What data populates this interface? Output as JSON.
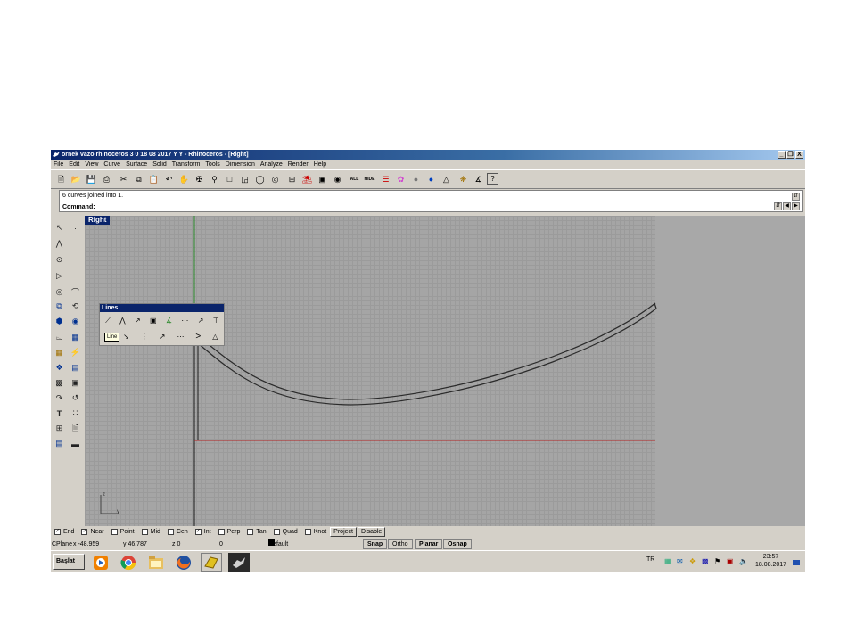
{
  "window": {
    "title": "örnek vazo rhinoceros 3 0 18 08 2017 Y Y - Rhinoceros - [Right]",
    "min": "_",
    "max": "❒",
    "close": "X"
  },
  "menu": [
    "File",
    "Edit",
    "View",
    "Curve",
    "Surface",
    "Solid",
    "Transform",
    "Tools",
    "Dimension",
    "Analyze",
    "Render",
    "Help"
  ],
  "toolbar": {
    "icons": [
      "new-file-icon",
      "open-file-icon",
      "save-icon",
      "print-icon",
      "cut-icon",
      "copy-icon",
      "paste-icon",
      "undo-icon",
      "pan-hand-icon",
      "rotate-view-icon",
      "zoom-icon",
      "zoom-window-icon",
      "zoom-extents-icon",
      "zoom-selected-icon",
      "zoom-target-icon",
      "four-viewports-icon",
      "car-icon",
      "layer-icon",
      "snapshot-icon",
      "show-all-icon",
      "hide-icon",
      "layers-stack-icon",
      "color-wheel-icon",
      "sphere-grey-icon",
      "sphere-blue-icon",
      "light-icon",
      "render-gear-icon",
      "dimension-icon",
      "help-icon"
    ],
    "all_label": "ALL",
    "hide_label": "HIDE"
  },
  "command": {
    "history": "6 curves joined into 1.",
    "prompt": "Command:"
  },
  "viewport": {
    "label": "Right",
    "axis_z": "z",
    "axis_y": "y"
  },
  "lines_toolbar": {
    "title": "Lines",
    "tooltip": "Line"
  },
  "osnap": {
    "items": [
      {
        "label": "End",
        "checked": true
      },
      {
        "label": "Near",
        "checked": true
      },
      {
        "label": "Point",
        "checked": false
      },
      {
        "label": "Mid",
        "checked": false
      },
      {
        "label": "Cen",
        "checked": false
      },
      {
        "label": "Int",
        "checked": true
      },
      {
        "label": "Perp",
        "checked": false
      },
      {
        "label": "Tan",
        "checked": false
      },
      {
        "label": "Quad",
        "checked": false
      },
      {
        "label": "Knot",
        "checked": false
      }
    ],
    "project": "Project",
    "disable": "Disable"
  },
  "status": {
    "cplane": "CPlane",
    "x": "x -48.959",
    "y": "y 46.787",
    "z": "z 0",
    "extra": "0",
    "layer": "Default",
    "snap": "Snap",
    "ortho": "Ortho",
    "planar": "Planar",
    "osnap": "Osnap"
  },
  "taskbar": {
    "start": "Başlat",
    "apps": [
      "media-player-icon",
      "chrome-icon",
      "file-explorer-icon",
      "firefox-icon",
      "rhino-icon",
      "rhino-app-active-icon"
    ],
    "lang": "TR",
    "time": "23:57",
    "date": "18.08.2017"
  },
  "colors": {
    "title_dark": "#0a246a",
    "viewport_bg": "#a5a5a5",
    "x_axis": "#b22222",
    "y_axis": "#2e8b2e"
  }
}
